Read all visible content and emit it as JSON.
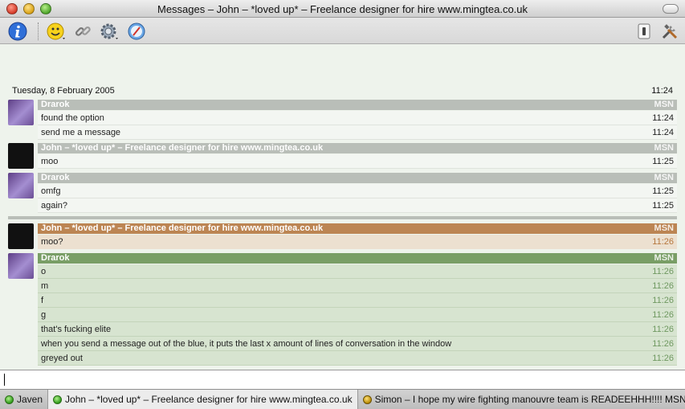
{
  "window": {
    "title": "Messages – John – *loved up* – Freelance designer for hire www.mingtea.co.uk"
  },
  "toolbar": {
    "icons": [
      "info-icon",
      "smiley-icon",
      "link-icon",
      "gear-icon",
      "safari-icon",
      "lightswitch-icon",
      "tools-icon"
    ]
  },
  "chat": {
    "date": "Tuesday, 8 February 2005",
    "date_time": "11:24",
    "groups": [
      {
        "sender": "Drarok",
        "protocol": "MSN",
        "style": "grey",
        "messages": [
          {
            "text": "found the option",
            "time": "11:24"
          },
          {
            "text": "send me a message",
            "time": "11:24"
          }
        ]
      },
      {
        "sender": "John – *loved up* – Freelance designer for hire www.mingtea.co.uk",
        "protocol": "MSN",
        "style": "grey",
        "messages": [
          {
            "text": "moo",
            "time": "11:25"
          }
        ]
      },
      {
        "sender": "Drarok",
        "protocol": "MSN",
        "style": "grey",
        "messages": [
          {
            "text": "omfg",
            "time": "11:25"
          },
          {
            "text": "again?",
            "time": "11:25"
          }
        ]
      },
      {
        "sender": "John – *loved up* – Freelance designer for hire www.mingtea.co.uk",
        "protocol": "MSN",
        "style": "brown",
        "messages": [
          {
            "text": "moo?",
            "time": "11:26"
          }
        ]
      },
      {
        "sender": "Drarok",
        "protocol": "MSN",
        "style": "green",
        "messages": [
          {
            "text": "o",
            "time": "11:26"
          },
          {
            "text": "m",
            "time": "11:26"
          },
          {
            "text": "f",
            "time": "11:26"
          },
          {
            "text": "g",
            "time": "11:26"
          },
          {
            "text": "that's fucking elite",
            "time": "11:26"
          },
          {
            "text": "when you send a message out of the blue, it puts the last x amount of lines of conversation in the window",
            "time": "11:26"
          },
          {
            "text": "greyed out",
            "time": "11:26"
          }
        ]
      }
    ]
  },
  "input": {
    "value": ""
  },
  "tabs": [
    {
      "label": "Javen",
      "status": "online"
    },
    {
      "label": "John – *loved up* – Freelance designer for hire www.mingtea.co.uk",
      "status": "online"
    },
    {
      "label": "Simon – I hope my wire fighting manouvre team is READEEHHH!!!! MSN",
      "status": "alert"
    }
  ],
  "colors": {
    "grey_header": "#b9beb8",
    "brown_header": "#bc8553",
    "green_header": "#799e66"
  }
}
